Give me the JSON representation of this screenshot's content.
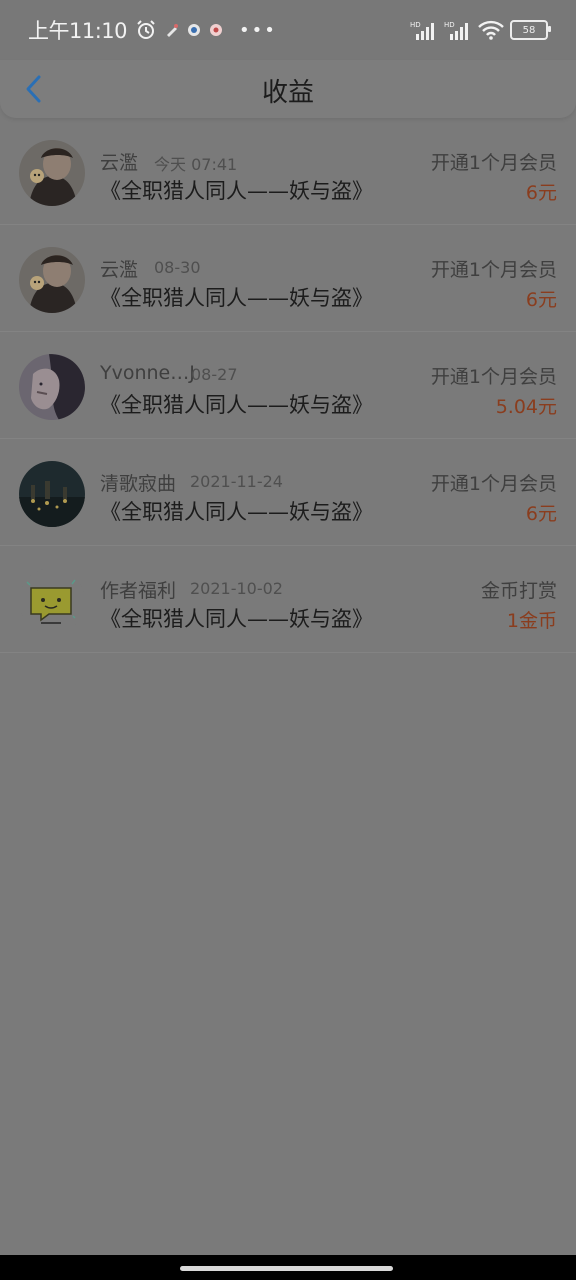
{
  "status_bar": {
    "time": "上午11:10",
    "battery": "58",
    "more": "•••"
  },
  "header": {
    "title": "收益"
  },
  "items": [
    {
      "name": "云濫",
      "date": "今天 07:41",
      "book": "《全职猎人同人——妖与盗》",
      "type": "开通1个月会员",
      "amount": "6元"
    },
    {
      "name": "云濫",
      "date": "08-30",
      "book": "《全职猎人同人——妖与盗》",
      "type": "开通1个月会员",
      "amount": "6元"
    },
    {
      "name": "Yvonne…J",
      "date": "08-27",
      "book": "《全职猎人同人——妖与盗》",
      "type": "开通1个月会员",
      "amount": "5.04元"
    },
    {
      "name": "清歌寂曲",
      "date": "2021-11-24",
      "book": "《全职猎人同人——妖与盗》",
      "type": "开通1个月会员",
      "amount": "6元"
    },
    {
      "name": "作者福利",
      "date": "2021-10-02",
      "book": "《全职猎人同人——妖与盗》",
      "type": "金币打赏",
      "amount": "1金币"
    }
  ]
}
